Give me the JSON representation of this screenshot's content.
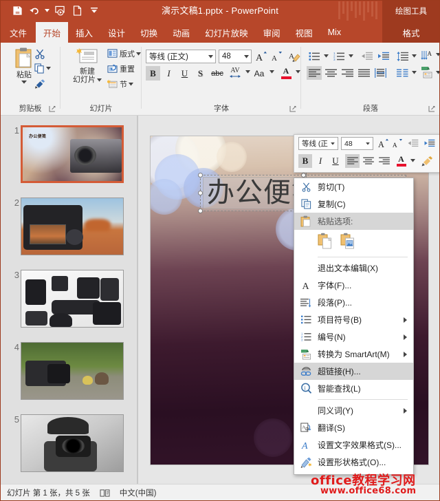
{
  "titlebar": {
    "document_title": "演示文稿1.pptx - PowerPoint",
    "contextual_tab_group": "绘图工具",
    "qat": [
      {
        "name": "save-icon",
        "label": "保存"
      },
      {
        "name": "undo-icon",
        "label": "撤消"
      },
      {
        "name": "start-slideshow-icon",
        "label": "从头开始"
      },
      {
        "name": "new-icon",
        "label": "新建"
      },
      {
        "name": "customize-qat-icon",
        "label": "自定义快速访问工具栏"
      }
    ]
  },
  "tabs": [
    {
      "label": "文件",
      "active": false,
      "kind": "file"
    },
    {
      "label": "开始",
      "active": true,
      "kind": "normal"
    },
    {
      "label": "插入",
      "active": false,
      "kind": "normal"
    },
    {
      "label": "设计",
      "active": false,
      "kind": "normal"
    },
    {
      "label": "切换",
      "active": false,
      "kind": "normal"
    },
    {
      "label": "动画",
      "active": false,
      "kind": "normal"
    },
    {
      "label": "幻灯片放映",
      "active": false,
      "kind": "normal"
    },
    {
      "label": "审阅",
      "active": false,
      "kind": "normal"
    },
    {
      "label": "视图",
      "active": false,
      "kind": "normal"
    },
    {
      "label": "Mix",
      "active": false,
      "kind": "normal"
    },
    {
      "label": "格式",
      "active": false,
      "kind": "contextual"
    }
  ],
  "ribbon": {
    "groups": [
      {
        "name": "clipboard",
        "label": "剪贴板"
      },
      {
        "name": "slides",
        "label": "幻灯片"
      },
      {
        "name": "font",
        "label": "字体"
      },
      {
        "name": "paragraph",
        "label": "段落"
      }
    ],
    "clipboard": {
      "paste_label": "粘贴",
      "cut_label": "剪切",
      "copy_label": "复制",
      "format_painter_label": "格式刷"
    },
    "slides": {
      "new_slide_line1": "新建",
      "new_slide_line2": "幻灯片",
      "layout_label": "版式",
      "reset_label": "重置",
      "section_label": "节"
    },
    "font": {
      "font_family_value": "等线 (正文)",
      "font_size_value": "48",
      "grow_font_label": "A",
      "shrink_font_label": "A",
      "clear_format_label": "清除所有格式",
      "bold_label": "B",
      "italic_label": "I",
      "underline_label": "U",
      "strikethrough_label": "S",
      "shadow_label": "abc",
      "spacing_label": "AV",
      "case_label": "Aa",
      "font_color_label": "A",
      "font_color_value": "#E8112D"
    }
  },
  "slides_pane": {
    "thumbnails": [
      {
        "number": "1",
        "selected": true,
        "caption": "办公便笺"
      },
      {
        "number": "2",
        "selected": false,
        "caption": ""
      },
      {
        "number": "3",
        "selected": false,
        "caption": ""
      },
      {
        "number": "4",
        "selected": false,
        "caption": ""
      },
      {
        "number": "5",
        "selected": false,
        "caption": ""
      }
    ]
  },
  "slide": {
    "title_text": "办公便笺"
  },
  "mini_toolbar": {
    "font_family_value": "等线 (正文",
    "font_size_value": "48",
    "grow_font_label": "A",
    "shrink_font_label": "A",
    "decrease_indent_label": "减少缩进量",
    "increase_indent_label": "增加缩进量",
    "bold_label": "B",
    "italic_label": "I",
    "underline_label": "U",
    "align_left_label": "左对齐",
    "align_center_label": "居中",
    "align_right_label": "右对齐",
    "font_color_label": "A",
    "font_color_value": "#E8112D",
    "format_painter_label": "格式刷"
  },
  "context_menu": {
    "items": [
      {
        "type": "item",
        "label": "剪切(T)",
        "icon": "scissors-icon",
        "submenu": false,
        "highlighted": false,
        "accel": "T"
      },
      {
        "type": "item",
        "label": "复制(C)",
        "icon": "copy-icon",
        "submenu": false,
        "highlighted": false,
        "accel": "C"
      },
      {
        "type": "header",
        "label": "粘贴选项:",
        "icon": "paste-icon",
        "submenu": false,
        "highlighted": true,
        "accel": ""
      },
      {
        "type": "paste-options",
        "options": [
          {
            "name": "paste-keep-text-only-icon",
            "label": "只保留文本"
          },
          {
            "name": "paste-picture-icon",
            "label": "图片"
          }
        ]
      },
      {
        "type": "separator"
      },
      {
        "type": "item",
        "label": "退出文本编辑(X)",
        "icon": "",
        "submenu": false,
        "highlighted": false,
        "accel": "X"
      },
      {
        "type": "item",
        "label": "字体(F)...",
        "icon": "font-a-icon",
        "submenu": false,
        "highlighted": false,
        "accel": "F"
      },
      {
        "type": "item",
        "label": "段落(P)...",
        "icon": "paragraph-icon",
        "submenu": false,
        "highlighted": false,
        "accel": "P"
      },
      {
        "type": "item",
        "label": "项目符号(B)",
        "icon": "bullets-icon",
        "submenu": true,
        "highlighted": false,
        "accel": "B"
      },
      {
        "type": "item",
        "label": "编号(N)",
        "icon": "numbering-icon",
        "submenu": true,
        "highlighted": false,
        "accel": "N"
      },
      {
        "type": "item",
        "label": "转换为 SmartArt(M)",
        "icon": "smartart-icon",
        "submenu": true,
        "highlighted": false,
        "accel": "M"
      },
      {
        "type": "item",
        "label": "超链接(H)...",
        "icon": "hyperlink-icon",
        "submenu": false,
        "highlighted": true,
        "accel": "H"
      },
      {
        "type": "item",
        "label": "智能查找(L)",
        "icon": "smart-lookup-icon",
        "submenu": false,
        "highlighted": false,
        "accel": "L"
      },
      {
        "type": "separator"
      },
      {
        "type": "item",
        "label": "同义词(Y)",
        "icon": "",
        "submenu": true,
        "highlighted": false,
        "accel": "Y"
      },
      {
        "type": "item",
        "label": "翻译(S)",
        "icon": "translate-icon",
        "submenu": false,
        "highlighted": false,
        "accel": "S"
      },
      {
        "type": "item",
        "label": "设置文字效果格式(S)...",
        "icon": "text-effects-icon",
        "submenu": false,
        "highlighted": false,
        "accel": "S"
      },
      {
        "type": "item",
        "label": "设置形状格式(O)...",
        "icon": "shape-format-icon",
        "submenu": false,
        "highlighted": false,
        "accel": "O"
      }
    ]
  },
  "statusbar": {
    "slide_count_text": "幻灯片 第 1 张，共 5 张",
    "notes_icon_label": "备注",
    "language_text": "中文(中国)"
  },
  "watermark": {
    "line1": "office教程学习网",
    "line2": "www.office68.com",
    "color": "#e01b1b"
  },
  "colors": {
    "brand_orange": "#b7472a",
    "brand_orange_dark": "#9e3a1f",
    "ribbon_bg": "#f1f1f1",
    "pane_bg": "#e0e0e0",
    "slide_area_bg": "#e6e6e6",
    "selection_border": "#d45b36",
    "menu_highlight": "#d6d6d6"
  }
}
